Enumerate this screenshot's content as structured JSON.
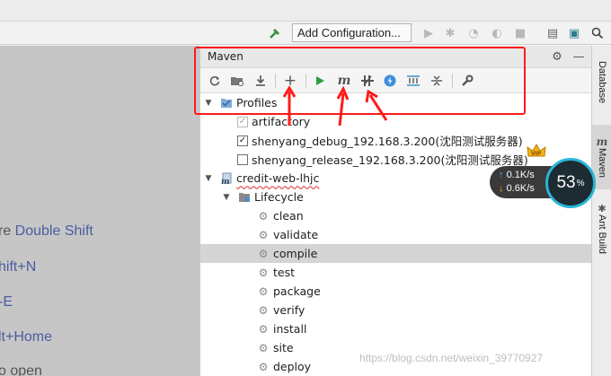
{
  "toolbar": {
    "run_config_label": "Add Configuration..."
  },
  "editor_hints": [
    {
      "prefix": "re ",
      "shortcut": "Double Shift"
    },
    {
      "prefix": "",
      "shortcut": "hift+N"
    },
    {
      "prefix": "",
      "shortcut": "-E"
    },
    {
      "prefix": "",
      "shortcut": "lt+Home"
    },
    {
      "prefix": "",
      "shortcut": "o open"
    }
  ],
  "maven": {
    "title": "Maven",
    "tree": {
      "profiles_label": "Profiles",
      "profiles": [
        {
          "label": "artifactory",
          "checked": true,
          "disabled": true
        },
        {
          "label": "shenyang_debug_192.168.3.200(沈阳测试服务器)",
          "checked": true,
          "disabled": false
        },
        {
          "label": "shenyang_release_192.168.3.200(沈阳测试服务器)",
          "checked": false,
          "disabled": false
        }
      ],
      "project_label": "credit-web-lhjc",
      "lifecycle_label": "Lifecycle",
      "lifecycle_items": [
        "clean",
        "validate",
        "compile",
        "test",
        "package",
        "verify",
        "install",
        "site",
        "deploy"
      ],
      "selected_item": "compile"
    }
  },
  "right_bar": {
    "tabs": [
      {
        "label": "Database",
        "active": false
      },
      {
        "label": "Maven",
        "active": true
      },
      {
        "label": "Ant Build",
        "active": false
      }
    ]
  },
  "speed_widget": {
    "upload": "0.1K/s",
    "download": "0.6K/s",
    "percent": "53",
    "percent_unit": "%",
    "badge": "VIP"
  },
  "watermark": "https://blog.csdn.net/weixin_39770927",
  "colors": {
    "annotation": "#ff1a1a",
    "selection": "#d4d4d4",
    "run_green": "#2f9e3a",
    "hint_link": "#4b5d9e"
  }
}
